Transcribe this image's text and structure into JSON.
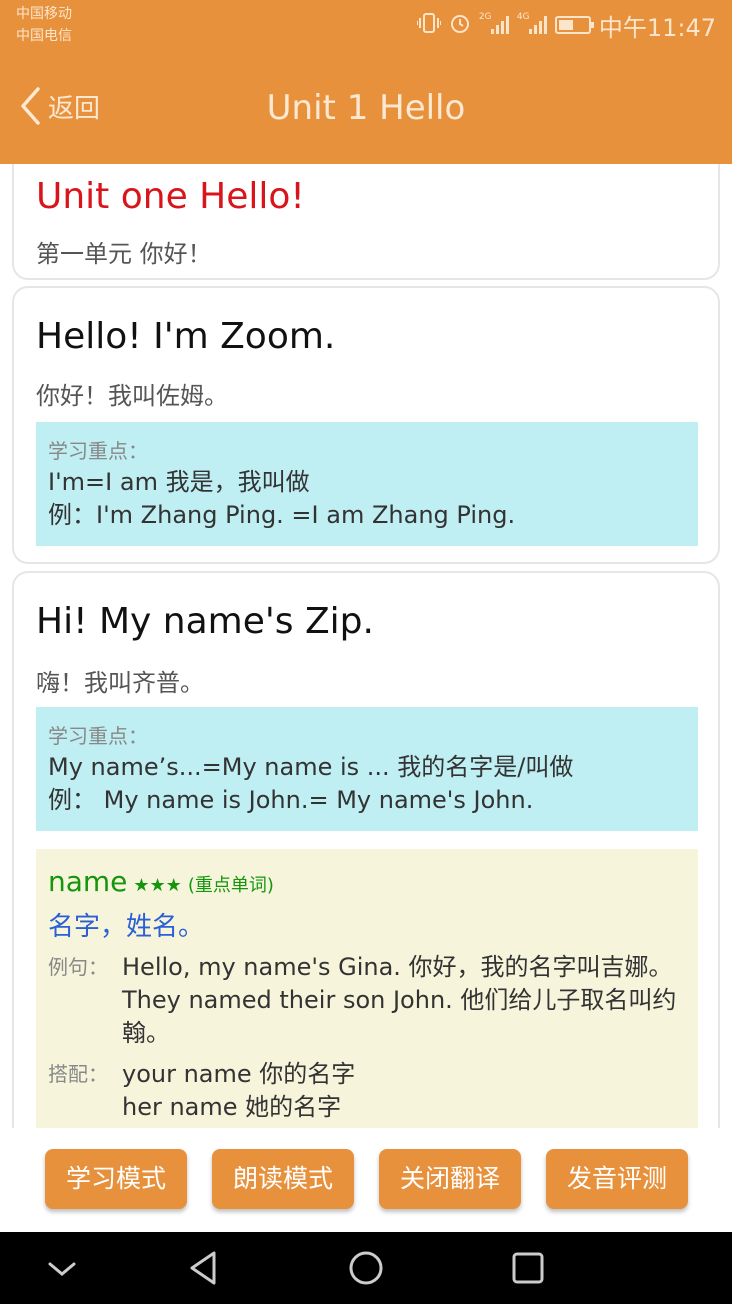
{
  "status_bar": {
    "carrier1": "中国移动",
    "carrier2": "中国电信",
    "signal1_tag": "2G",
    "signal2_tag": "4G",
    "time": "中午11:47",
    "icons": [
      "vibrate-icon",
      "alarm-icon",
      "signal-icon",
      "signal-icon",
      "battery-icon"
    ]
  },
  "nav": {
    "back_label": "返回",
    "title": "Unit 1 Hello"
  },
  "cards": {
    "unit": {
      "title": "Unit one Hello!",
      "subtitle": "第一单元 你好！"
    },
    "sentence1": {
      "en": "Hello! I'm Zoom.",
      "zh": "你好！我叫佐姆。",
      "note_label": "学习重点：",
      "note_line1": "I'm=I am 我是，我叫做",
      "note_line2": "例：I'm Zhang Ping. =I am Zhang Ping."
    },
    "sentence2": {
      "en": "Hi! My name's Zip.",
      "zh": "嗨！我叫齐普。",
      "note_label": "学习重点：",
      "note_line1": "My name’s...=My name is ... 我的名字是/叫做",
      "note_line2": "例： My name is John.= My name's John.",
      "vocab": {
        "word": "name",
        "stars": "★★★",
        "tag": "(重点单词)",
        "meaning": "名字，姓名。",
        "example_key": "例句：",
        "example1": "Hello, my name's Gina. 你好，我的名字叫吉娜。",
        "example2": "They named their son John. 他们给儿子取名叫约翰。",
        "collocation_key": "搭配：",
        "collocation1": "your name 你的名字",
        "collocation2": "her name 她的名字"
      }
    }
  },
  "buttons": {
    "study_mode": "学习模式",
    "read_mode": "朗读模式",
    "close_translation": "关闭翻译",
    "pronunciation_test": "发音评测"
  },
  "colors": {
    "brand": "#e8913c",
    "unit_title": "#d8151b",
    "note_bg": "#bfeef3",
    "vocab_bg": "#f6f5dc",
    "vocab_word": "#15960c",
    "vocab_meaning": "#2c5fd6"
  },
  "battery_level": 0.5
}
